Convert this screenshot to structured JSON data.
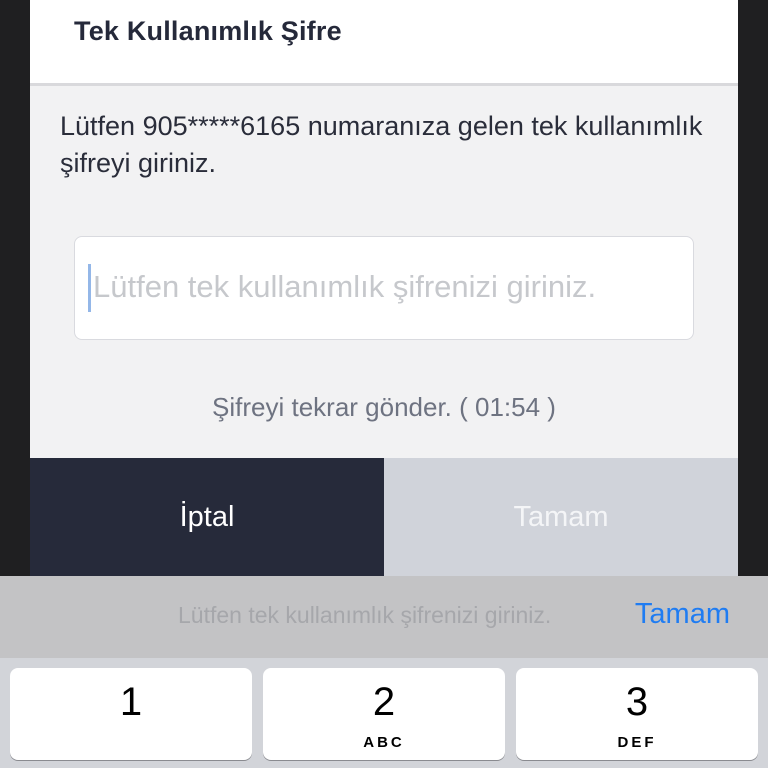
{
  "dialog": {
    "title": "Tek Kullanımlık Şifre",
    "message": "Lütfen 905*****6165 numaranıza gelen tek kullanımlık şifreyi giriniz.",
    "input": {
      "value": "",
      "placeholder": "Lütfen tek kullanımlık şifrenizi giriniz."
    },
    "resend": "Şifreyi tekrar gönder. ( 01:54 )",
    "cancel_label": "İptal",
    "ok_label": "Tamam"
  },
  "keyboard": {
    "toolbar": {
      "placeholder": "Lütfen tek kullanımlık şifrenizi giriniz.",
      "done_label": "Tamam"
    },
    "keys": [
      {
        "digit": "1",
        "letters": ""
      },
      {
        "digit": "2",
        "letters": "ABC"
      },
      {
        "digit": "3",
        "letters": "DEF"
      }
    ]
  },
  "colors": {
    "primary_dark": "#262a3a",
    "disabled_button": "#d0d3da",
    "link_blue": "#1f7cf2"
  }
}
